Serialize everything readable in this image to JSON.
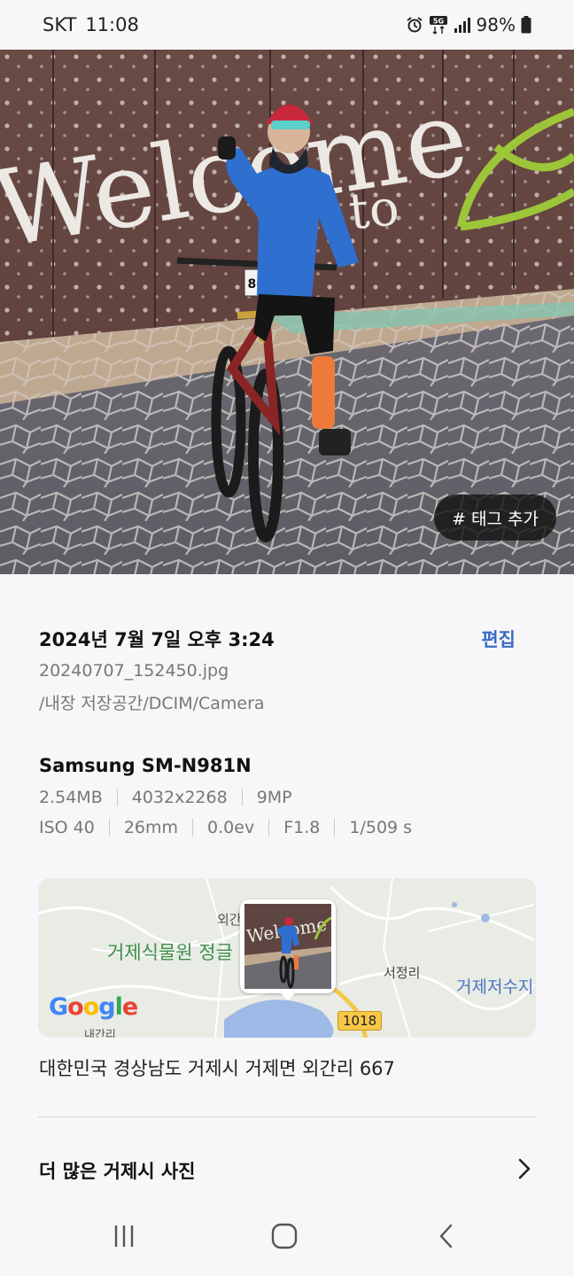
{
  "status_bar": {
    "carrier": "SKT",
    "time": "11:08",
    "network_badge": "5G",
    "battery": "98%",
    "icons": [
      "alarm-icon",
      "network-5g-icon",
      "signal-icon",
      "battery-icon"
    ]
  },
  "photo": {
    "tag_button_label": "# 태그 추가",
    "sign_text": "Welcome",
    "sign_text_small": "to",
    "bib_number": "8602"
  },
  "details": {
    "date": "2024년 7월 7일 오후 3:24",
    "edit_label": "편집",
    "file_name": "20240707_152450.jpg",
    "file_path": "/내장 저장공간/DCIM/Camera",
    "device": "Samsung SM-N981N",
    "meta_row1": [
      "2.54MB",
      "4032x2268",
      "9MP"
    ],
    "meta_row2": [
      "ISO 40",
      "26mm",
      "0.0ev",
      "F1.8",
      "1/509 s"
    ]
  },
  "map": {
    "labels": {
      "garden": "거제식물원 정글",
      "oegan": "외간",
      "seojeong": "서정리",
      "reservoir": "거제저수지",
      "naegan": "내간리",
      "road": "1018"
    },
    "logo": "Google"
  },
  "address": "대한민국 경상남도 거제시 거제면 외간리 667",
  "more_photos_label": "더 많은 거제시 사진",
  "nav": [
    "recent-apps-icon",
    "home-icon",
    "back-icon"
  ],
  "colors": {
    "background": "#f7f7f9",
    "accent": "#3a6cc4",
    "secondary_text": "#777777"
  }
}
